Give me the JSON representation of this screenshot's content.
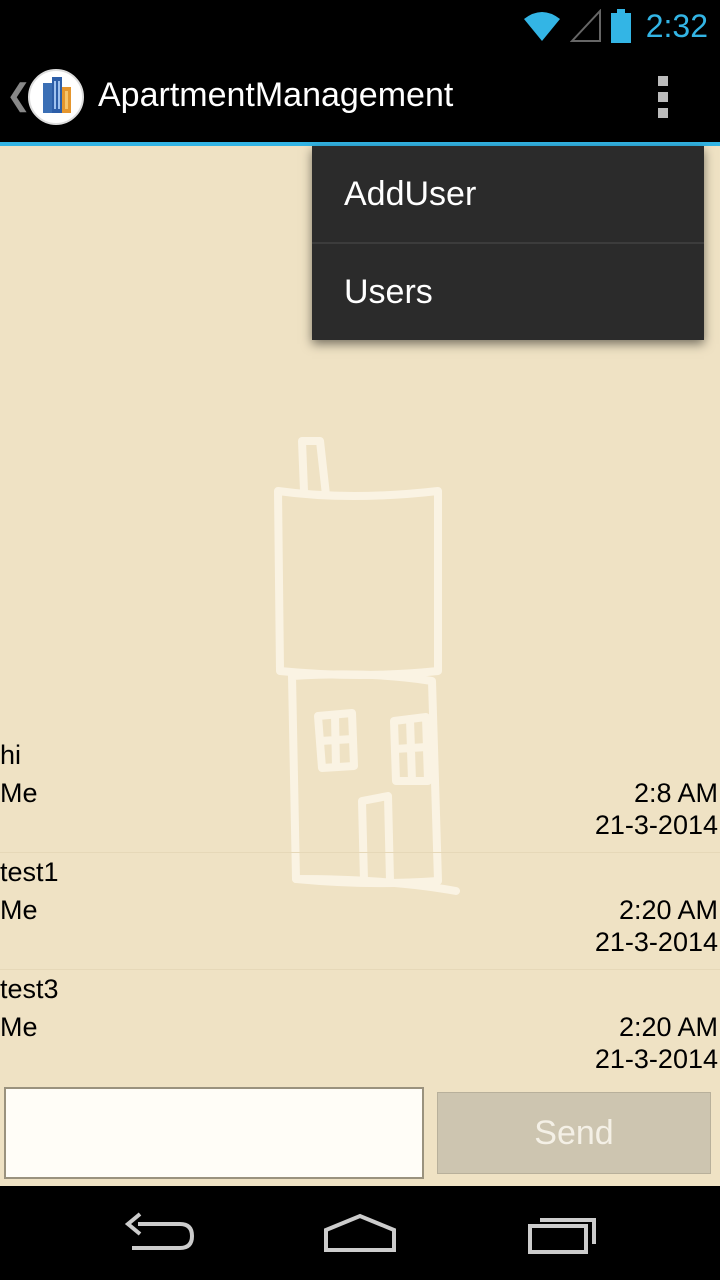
{
  "status_bar": {
    "time": "2:32",
    "icons": [
      "wifi-icon",
      "signal-icon",
      "battery-icon"
    ],
    "accent_color": "#33b5e5"
  },
  "action_bar": {
    "title": "ApartmentManagement",
    "icons": [
      "up-caret-icon",
      "app-icon",
      "overflow-menu-icon"
    ]
  },
  "menu": {
    "items": [
      "AddUser",
      "Users"
    ]
  },
  "messages": [
    {
      "body": "hi",
      "sender": "Me",
      "time": "2:8 AM",
      "date": "21-3-2014"
    },
    {
      "body": "test1",
      "sender": "Me",
      "time": "2:20 AM",
      "date": "21-3-2014"
    },
    {
      "body": "test3",
      "sender": "Me",
      "time": "2:20 AM",
      "date": "21-3-2014"
    }
  ],
  "composer": {
    "input_value": "",
    "send_label": "Send"
  },
  "nav_bar": {
    "icons": [
      "back-icon",
      "home-icon",
      "recents-icon"
    ]
  },
  "colors": {
    "content_background": "#efe2c4",
    "menu_background": "#2b2b2b"
  }
}
